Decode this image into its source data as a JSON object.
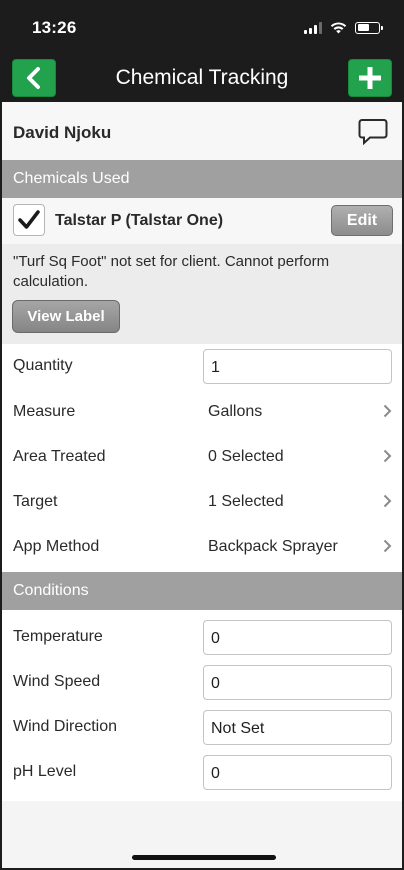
{
  "status": {
    "time": "13:26"
  },
  "nav": {
    "title": "Chemical Tracking",
    "back_icon": "chevron-left-icon",
    "add_icon": "plus-icon"
  },
  "client": {
    "name": "David Njoku",
    "chat_icon": "chat-bubble-icon"
  },
  "sections": {
    "chemicals": "Chemicals Used",
    "conditions": "Conditions"
  },
  "chemical": {
    "checked": true,
    "name": "Talstar P (Talstar One)",
    "edit_label": "Edit",
    "warning": "\"Turf Sq Foot\" not set for client. Cannot perform calculation.",
    "view_label": "View Label"
  },
  "fields": {
    "quantity": {
      "label": "Quantity",
      "value": "1"
    },
    "measure": {
      "label": "Measure",
      "value": "Gallons"
    },
    "area_treated": {
      "label": "Area Treated",
      "value": "0 Selected"
    },
    "target": {
      "label": "Target",
      "value": "1 Selected"
    },
    "app_method": {
      "label": "App Method",
      "value": "Backpack Sprayer"
    }
  },
  "conditions": {
    "temperature": {
      "label": "Temperature",
      "value": "0"
    },
    "wind_speed": {
      "label": "Wind Speed",
      "value": "0"
    },
    "wind_direction": {
      "label": "Wind Direction",
      "value": "Not Set"
    },
    "ph_level": {
      "label": "pH Level",
      "value": "0"
    }
  },
  "colors": {
    "accent_green": "#23a24d",
    "section_gray": "#a0a0a0",
    "dark_bar": "#1c1c1c"
  }
}
